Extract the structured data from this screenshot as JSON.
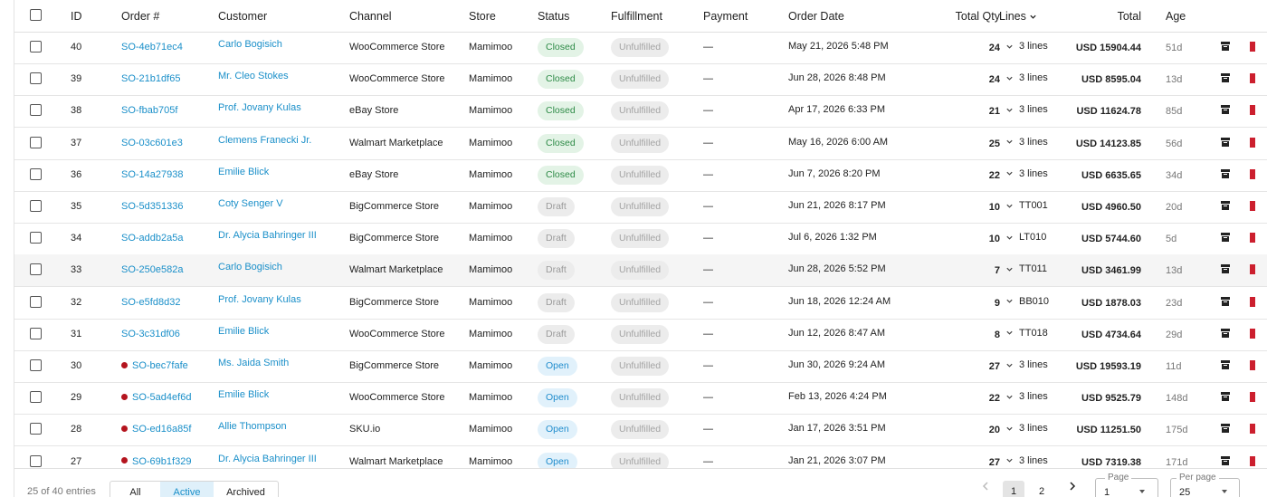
{
  "table": {
    "headers": {
      "id": "ID",
      "order": "Order #",
      "customer": "Customer",
      "channel": "Channel",
      "store": "Store",
      "status": "Status",
      "fulfillment": "Fulfillment",
      "payment": "Payment",
      "order_date": "Order Date",
      "total_qty": "Total Qty",
      "lines": "Lines",
      "total": "Total",
      "age": "Age"
    },
    "rows": [
      {
        "id": "40",
        "order": "SO-4eb71ec4",
        "flag": false,
        "customer": "Carlo Bogisich",
        "channel": "WooCommerce Store",
        "store": "Mamimoo",
        "status": "Closed",
        "status_kind": "closed",
        "fulfillment": "Unfulfilled",
        "payment": "—",
        "date": "May 21, 2026 5:48 PM",
        "qty": "24",
        "lines": "3 lines",
        "total": "USD 15904.44",
        "age": "51d"
      },
      {
        "id": "39",
        "order": "SO-21b1df65",
        "flag": false,
        "customer": "Mr. Cleo Stokes",
        "channel": "WooCommerce Store",
        "store": "Mamimoo",
        "status": "Closed",
        "status_kind": "closed",
        "fulfillment": "Unfulfilled",
        "payment": "—",
        "date": "Jun 28, 2026 8:48 PM",
        "qty": "24",
        "lines": "3 lines",
        "total": "USD 8595.04",
        "age": "13d"
      },
      {
        "id": "38",
        "order": "SO-fbab705f",
        "flag": false,
        "customer": "Prof. Jovany Kulas",
        "channel": "eBay Store",
        "store": "Mamimoo",
        "status": "Closed",
        "status_kind": "closed",
        "fulfillment": "Unfulfilled",
        "payment": "—",
        "date": "Apr 17, 2026 6:33 PM",
        "qty": "21",
        "lines": "3 lines",
        "total": "USD 11624.78",
        "age": "85d"
      },
      {
        "id": "37",
        "order": "SO-03c601e3",
        "flag": false,
        "customer": "Clemens Franecki Jr.",
        "channel": "Walmart Marketplace",
        "store": "Mamimoo",
        "status": "Closed",
        "status_kind": "closed",
        "fulfillment": "Unfulfilled",
        "payment": "—",
        "date": "May 16, 2026 6:00 AM",
        "qty": "25",
        "lines": "3 lines",
        "total": "USD 14123.85",
        "age": "56d"
      },
      {
        "id": "36",
        "order": "SO-14a27938",
        "flag": false,
        "customer": "Emilie Blick",
        "channel": "eBay Store",
        "store": "Mamimoo",
        "status": "Closed",
        "status_kind": "closed",
        "fulfillment": "Unfulfilled",
        "payment": "—",
        "date": "Jun 7, 2026 8:20 PM",
        "qty": "22",
        "lines": "3 lines",
        "total": "USD 6635.65",
        "age": "34d"
      },
      {
        "id": "35",
        "order": "SO-5d351336",
        "flag": false,
        "customer": "Coty Senger V",
        "channel": "BigCommerce Store",
        "store": "Mamimoo",
        "status": "Draft",
        "status_kind": "draft",
        "fulfillment": "Unfulfilled",
        "payment": "—",
        "date": "Jun 21, 2026 8:17 PM",
        "qty": "10",
        "lines": "TT001",
        "total": "USD 4960.50",
        "age": "20d"
      },
      {
        "id": "34",
        "order": "SO-addb2a5a",
        "flag": false,
        "customer": "Dr. Alycia Bahringer III",
        "channel": "BigCommerce Store",
        "store": "Mamimoo",
        "status": "Draft",
        "status_kind": "draft",
        "fulfillment": "Unfulfilled",
        "payment": "—",
        "date": "Jul 6, 2026 1:32 PM",
        "qty": "10",
        "lines": "LT010",
        "total": "USD 5744.60",
        "age": "5d"
      },
      {
        "id": "33",
        "order": "SO-250e582a",
        "flag": false,
        "customer": "Carlo Bogisich",
        "channel": "Walmart Marketplace",
        "store": "Mamimoo",
        "status": "Draft",
        "status_kind": "draft",
        "fulfillment": "Unfulfilled",
        "payment": "—",
        "date": "Jun 28, 2026 5:52 PM",
        "qty": "7",
        "lines": "TT011",
        "total": "USD 3461.99",
        "age": "13d",
        "alt": true
      },
      {
        "id": "32",
        "order": "SO-e5fd8d32",
        "flag": false,
        "customer": "Prof. Jovany Kulas",
        "channel": "BigCommerce Store",
        "store": "Mamimoo",
        "status": "Draft",
        "status_kind": "draft",
        "fulfillment": "Unfulfilled",
        "payment": "—",
        "date": "Jun 18, 2026 12:24 AM",
        "qty": "9",
        "lines": "BB010",
        "total": "USD 1878.03",
        "age": "23d"
      },
      {
        "id": "31",
        "order": "SO-3c31df06",
        "flag": false,
        "customer": "Emilie Blick",
        "channel": "WooCommerce Store",
        "store": "Mamimoo",
        "status": "Draft",
        "status_kind": "draft",
        "fulfillment": "Unfulfilled",
        "payment": "—",
        "date": "Jun 12, 2026 8:47 AM",
        "qty": "8",
        "lines": "TT018",
        "total": "USD 4734.64",
        "age": "29d"
      },
      {
        "id": "30",
        "order": "SO-bec7fafe",
        "flag": true,
        "customer": "Ms. Jaida Smith",
        "channel": "BigCommerce Store",
        "store": "Mamimoo",
        "status": "Open",
        "status_kind": "open",
        "fulfillment": "Unfulfilled",
        "payment": "—",
        "date": "Jun 30, 2026 9:24 AM",
        "qty": "27",
        "lines": "3 lines",
        "total": "USD 19593.19",
        "age": "11d"
      },
      {
        "id": "29",
        "order": "SO-5ad4ef6d",
        "flag": true,
        "customer": "Emilie Blick",
        "channel": "WooCommerce Store",
        "store": "Mamimoo",
        "status": "Open",
        "status_kind": "open",
        "fulfillment": "Unfulfilled",
        "payment": "—",
        "date": "Feb 13, 2026 4:24 PM",
        "qty": "22",
        "lines": "3 lines",
        "total": "USD 9525.79",
        "age": "148d"
      },
      {
        "id": "28",
        "order": "SO-ed16a85f",
        "flag": true,
        "customer": "Allie Thompson",
        "channel": "SKU.io",
        "store": "Mamimoo",
        "status": "Open",
        "status_kind": "open",
        "fulfillment": "Unfulfilled",
        "payment": "—",
        "date": "Jan 17, 2026 3:51 PM",
        "qty": "20",
        "lines": "3 lines",
        "total": "USD 11251.50",
        "age": "175d"
      },
      {
        "id": "27",
        "order": "SO-69b1f329",
        "flag": true,
        "customer": "Dr. Alycia Bahringer III",
        "channel": "Walmart Marketplace",
        "store": "Mamimoo",
        "status": "Open",
        "status_kind": "open",
        "fulfillment": "Unfulfilled",
        "payment": "—",
        "date": "Jan 21, 2026 3:07 PM",
        "qty": "27",
        "lines": "3 lines",
        "total": "USD 7319.38",
        "age": "171d"
      }
    ]
  },
  "footer": {
    "entries": "25 of 40 entries",
    "tabs": [
      "All",
      "Active",
      "Archived"
    ],
    "active_tab": "Active",
    "pages": [
      "1",
      "2"
    ],
    "current_page": "1",
    "page_label": "Page",
    "page_value": "1",
    "per_page_label": "Per page",
    "per_page_value": "25"
  },
  "colors": {
    "link": "#1a8fc9",
    "closed_bg": "#e3f3e6",
    "closed_fg": "#2e8b47",
    "open_bg": "#e1f1fb",
    "open_fg": "#1f8ccd",
    "flag_dot": "#b4141e",
    "delete_icon": "#cc1f2e"
  },
  "icons": {
    "archive": "archive-icon",
    "delete": "trash-icon",
    "expand": "chevron-down-icon",
    "sort": "chevron-down-icon"
  }
}
